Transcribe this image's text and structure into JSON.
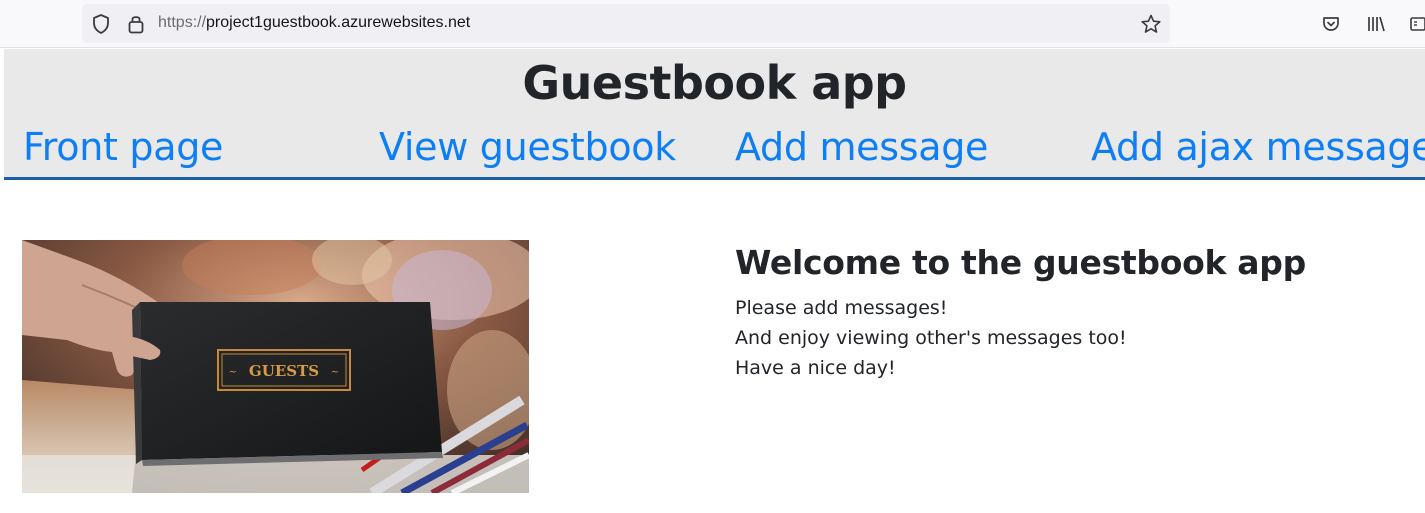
{
  "browser": {
    "url_scheme": "https://",
    "url_host": "project1guestbook.azurewebsites.net",
    "icons": [
      "shield-icon",
      "lock-icon",
      "bookmark-star-icon",
      "pocket-icon",
      "library-icon",
      "reader-view-icon"
    ]
  },
  "header": {
    "title": "Guestbook app",
    "nav": {
      "front_page": "Front page",
      "view_guestbook": "View guestbook",
      "add_message": "Add message",
      "add_ajax_message": "Add ajax message"
    },
    "link_color": "#0d7ef5",
    "background": "#e9e9e9",
    "rule_color": "#1a5fa8"
  },
  "hero": {
    "book_label": "GUESTS"
  },
  "main": {
    "welcome_title": "Welcome to the guestbook app",
    "line1": "Please add messages!",
    "line2": "And enjoy viewing other's messages too!",
    "line3": "Have a nice day!"
  }
}
